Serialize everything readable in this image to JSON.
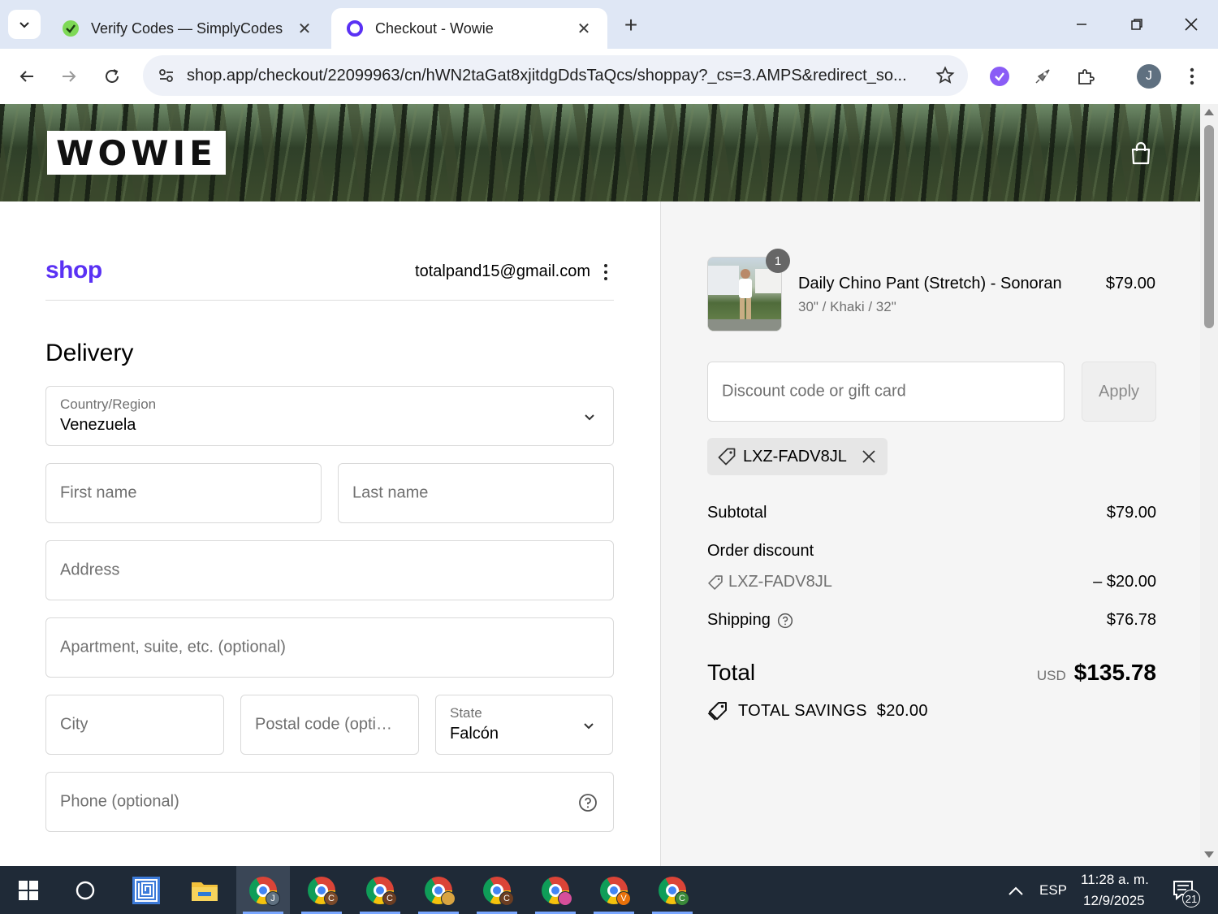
{
  "browser": {
    "tabs": [
      {
        "title": "Verify Codes — SimplyCodes",
        "active": false
      },
      {
        "title": "Checkout - Wowie",
        "active": true
      }
    ],
    "url": "shop.app/checkout/22099963/cn/hWN2taGat8xjitdgDdsTaQcs/shoppay?_cs=3.AMPS&redirect_so...",
    "profile_initial": "J"
  },
  "header": {
    "store_logo": "WOWIE"
  },
  "account": {
    "brand": "shop",
    "email": "totalpand15@gmail.com"
  },
  "delivery": {
    "title": "Delivery",
    "country": {
      "label": "Country/Region",
      "value": "Venezuela"
    },
    "first_name": {
      "placeholder": "First name",
      "value": ""
    },
    "last_name": {
      "placeholder": "Last name",
      "value": ""
    },
    "address": {
      "placeholder": "Address",
      "value": ""
    },
    "apartment": {
      "placeholder": "Apartment, suite, etc. (optional)",
      "value": ""
    },
    "city": {
      "placeholder": "City",
      "value": ""
    },
    "postal": {
      "placeholder": "Postal code (opti…",
      "value": ""
    },
    "state": {
      "label": "State",
      "value": "Falcón"
    },
    "phone": {
      "placeholder": "Phone (optional)",
      "value": ""
    }
  },
  "summary": {
    "product": {
      "quantity": "1",
      "name": "Daily Chino Pant (Stretch) - Sonoran",
      "variant": "30\" / Khaki / 32\"",
      "price": "$79.00"
    },
    "discount_placeholder": "Discount code or gift card",
    "apply_label": "Apply",
    "applied_code": "LXZ-FADV8JL",
    "subtotal_label": "Subtotal",
    "subtotal_value": "$79.00",
    "order_discount_label": "Order discount",
    "discount_code": "LXZ-FADV8JL",
    "discount_value": "– $20.00",
    "shipping_label": "Shipping",
    "shipping_value": "$76.78",
    "total_label": "Total",
    "currency": "USD",
    "total_value": "$135.78",
    "savings_label": "TOTAL SAVINGS",
    "savings_value": "$20.00"
  },
  "taskbar": {
    "chrome_badges": [
      "J",
      "C",
      "C",
      "",
      "C",
      "",
      "V",
      "C"
    ],
    "language": "ESP",
    "time": "11:28 a. m.",
    "date": "12/9/2025",
    "notifications": "21"
  },
  "colors": {
    "shop_purple": "#5a31f4",
    "tabstrip": "#dfe7f5",
    "taskbar": "#1f2a37"
  }
}
